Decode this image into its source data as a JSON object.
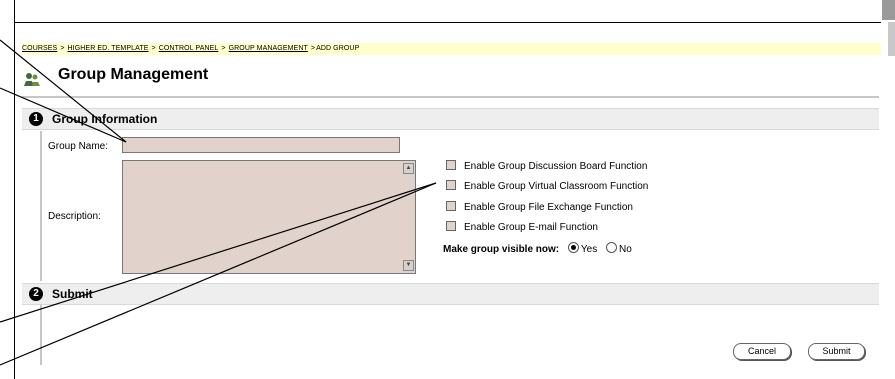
{
  "breadcrumb": {
    "items": [
      {
        "label": "COURSES",
        "link": true
      },
      {
        "label": "HIGHER ED. TEMPLATE",
        "link": true
      },
      {
        "label": "CONTROL PANEL",
        "link": true
      },
      {
        "label": "GROUP MANAGEMENT",
        "link": true
      },
      {
        "label": "ADD GROUP",
        "link": false
      }
    ],
    "separator": ">"
  },
  "header": {
    "title": "Group Management",
    "icon": "group-management-icon"
  },
  "sections": [
    {
      "number": "1",
      "title": "Group Information"
    },
    {
      "number": "2",
      "title": "Submit"
    }
  ],
  "form": {
    "group_name_label": "Group Name:",
    "group_name_value": "",
    "description_label": "Description:",
    "description_value": "",
    "options": [
      {
        "label": "Enable Group Discussion Board Function",
        "checked": false
      },
      {
        "label": "Enable Group Virtual Classroom Function",
        "checked": false
      },
      {
        "label": "Enable Group File Exchange Function",
        "checked": false
      },
      {
        "label": "Enable Group E-mail Function",
        "checked": false
      }
    ],
    "visible_label": "Make group visible now:",
    "visible_yes": "Yes",
    "visible_no": "No",
    "visible_selected": "Yes"
  },
  "buttons": {
    "cancel": "Cancel",
    "submit": "Submit"
  },
  "colors": {
    "breadcrumb_bg": "#ffffcc",
    "input_bg": "#e2d2cc",
    "section_bg": "#eeeeee"
  }
}
